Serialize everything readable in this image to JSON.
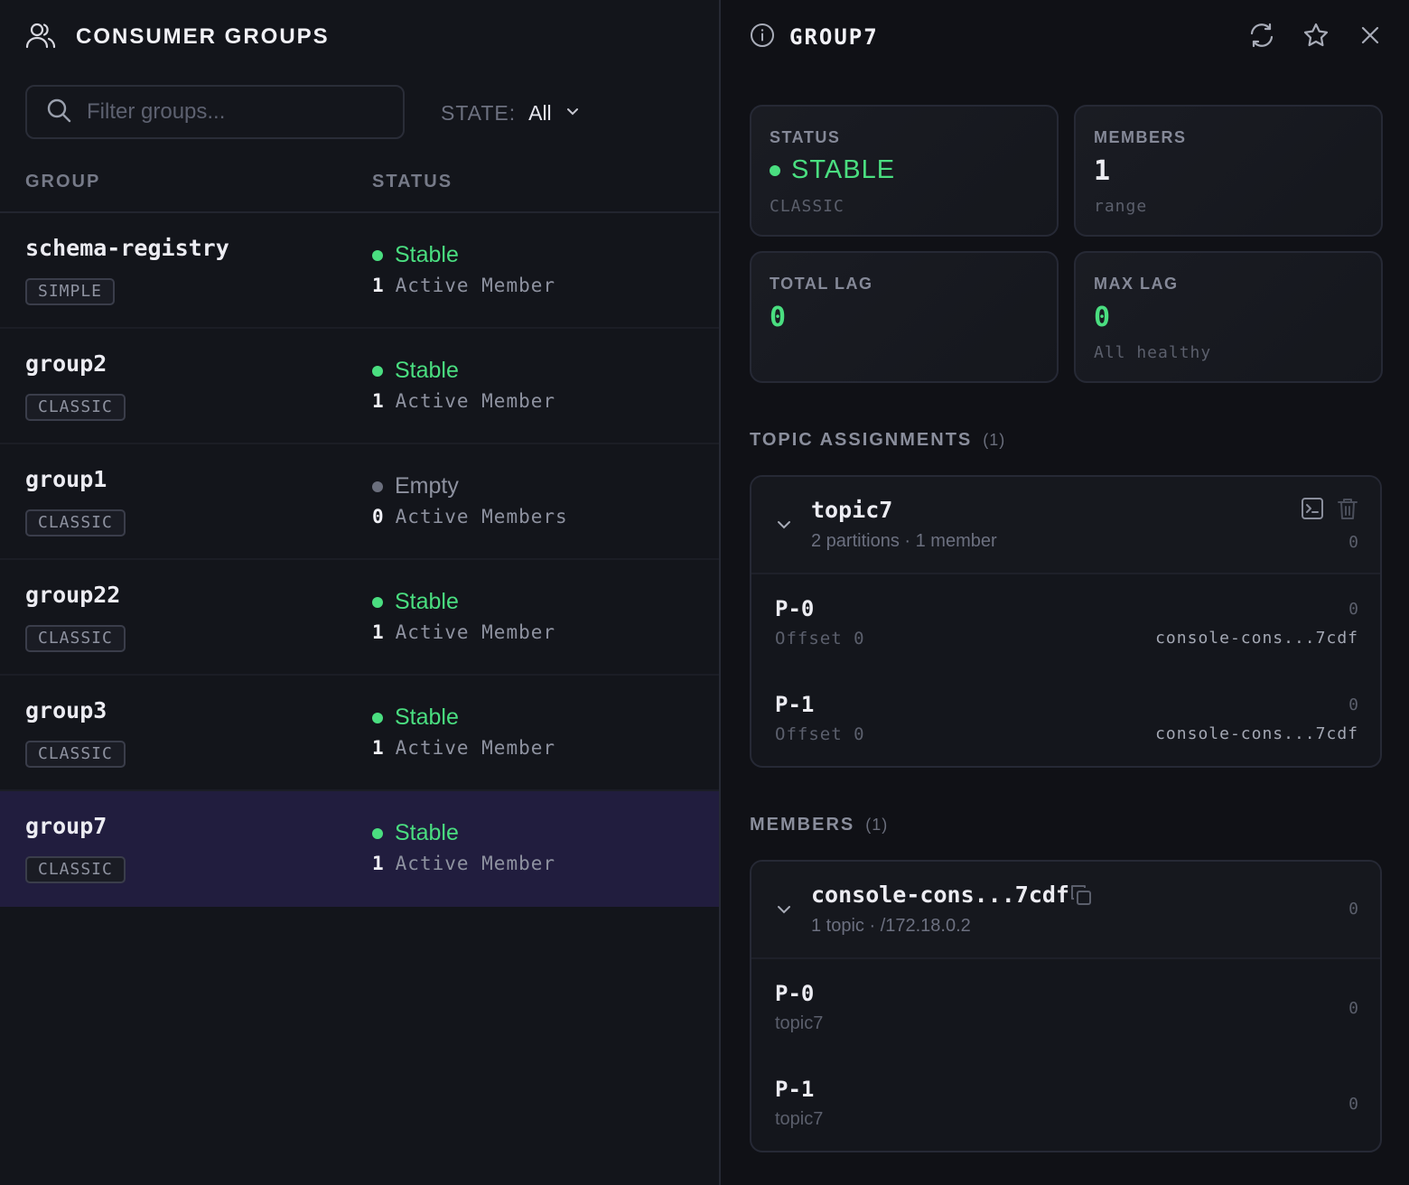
{
  "colors": {
    "accent_green": "#4ade80",
    "muted_gray": "#6b6f7d",
    "selected_bg": "#211d3e"
  },
  "left": {
    "title": "CONSUMER GROUPS",
    "search_placeholder": "Filter groups...",
    "state_label": "STATE:",
    "state_value": "All",
    "col_group": "GROUP",
    "col_status": "STATUS",
    "groups": [
      {
        "name": "schema-registry",
        "type": "SIMPLE",
        "status": "Stable",
        "status_color": "#4ade80",
        "count": "1",
        "members_label": "Active Member"
      },
      {
        "name": "group2",
        "type": "CLASSIC",
        "status": "Stable",
        "status_color": "#4ade80",
        "count": "1",
        "members_label": "Active Member"
      },
      {
        "name": "group1",
        "type": "CLASSIC",
        "status": "Empty",
        "status_color": "#6b6f7d",
        "count": "0",
        "members_label": "Active Members"
      },
      {
        "name": "group22",
        "type": "CLASSIC",
        "status": "Stable",
        "status_color": "#4ade80",
        "count": "1",
        "members_label": "Active Member"
      },
      {
        "name": "group3",
        "type": "CLASSIC",
        "status": "Stable",
        "status_color": "#4ade80",
        "count": "1",
        "members_label": "Active Member"
      },
      {
        "name": "group7",
        "type": "CLASSIC",
        "status": "Stable",
        "status_color": "#4ade80",
        "count": "1",
        "members_label": "Active Member",
        "selected": true
      }
    ]
  },
  "detail": {
    "title": "GROUP7",
    "cards": {
      "status": {
        "label": "STATUS",
        "value": "STABLE",
        "sub": "CLASSIC"
      },
      "members": {
        "label": "MEMBERS",
        "value": "1",
        "sub": "range"
      },
      "total_lag": {
        "label": "TOTAL LAG",
        "value": "0"
      },
      "max_lag": {
        "label": "MAX LAG",
        "value": "0",
        "sub": "All healthy"
      }
    },
    "topic_assignments": {
      "title": "TOPIC ASSIGNMENTS",
      "count": "(1)",
      "topic": {
        "name": "topic7",
        "sub": "2 partitions · 1 member",
        "lag": "0",
        "partitions": [
          {
            "name": "P-0",
            "offset": "Offset 0",
            "lag": "0",
            "consumer": "console-cons...7cdf"
          },
          {
            "name": "P-1",
            "offset": "Offset 0",
            "lag": "0",
            "consumer": "console-cons...7cdf"
          }
        ]
      }
    },
    "members": {
      "title": "MEMBERS",
      "count": "(1)",
      "member": {
        "name": "console-cons...7cdf",
        "sub": "1 topic · /172.18.0.2",
        "lag": "0",
        "partitions": [
          {
            "name": "P-0",
            "topic": "topic7",
            "lag": "0"
          },
          {
            "name": "P-1",
            "topic": "topic7",
            "lag": "0"
          }
        ]
      }
    }
  }
}
